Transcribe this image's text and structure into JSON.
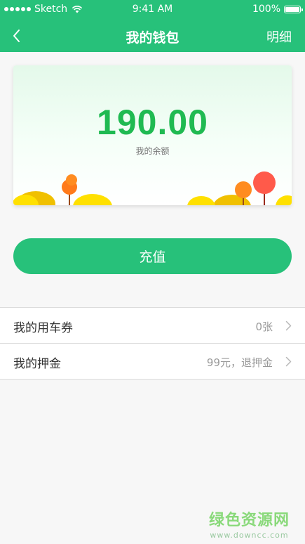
{
  "status_bar": {
    "carrier": "Sketch",
    "time": "9:41 AM",
    "battery": "100%"
  },
  "nav": {
    "title": "我的钱包",
    "detail_label": "明细"
  },
  "wallet": {
    "balance": "190.00",
    "balance_label": "我的余额"
  },
  "recharge_label": "充值",
  "list_items": [
    {
      "label": "我的用车券",
      "value": "0张"
    },
    {
      "label": "我的押金",
      "value": "99元，退押金"
    }
  ],
  "watermark": {
    "main": "绿色资源网",
    "sub": "www.downcc.com"
  },
  "colors": {
    "primary": "#27c17a",
    "balance": "#20ba52",
    "background": "#f7f7f7"
  },
  "icons": {
    "back": "chevron-left-icon",
    "row_arrow": "chevron-right-icon",
    "wifi": "wifi-icon",
    "battery": "battery-icon"
  }
}
